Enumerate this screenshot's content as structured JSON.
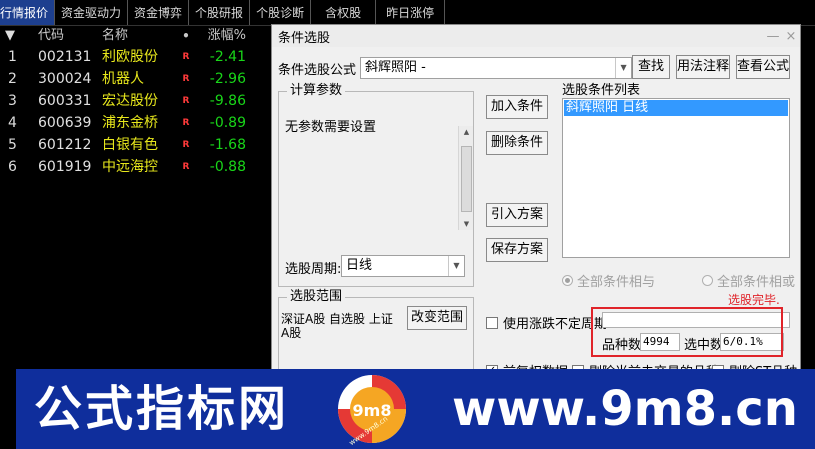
{
  "tabs": [
    "行情报价",
    "资金驱动力",
    "资金博弈",
    "个股研报",
    "个股诊断",
    "含权股",
    "昨日涨停"
  ],
  "table": {
    "headers": {
      "arrow": "▼",
      "code": "代码",
      "name": "名称",
      "flag": "•",
      "change": "涨幅%"
    },
    "rows": [
      {
        "idx": "1",
        "code": "002131",
        "name": "利欧股份",
        "flag": "R",
        "change": "-2.41"
      },
      {
        "idx": "2",
        "code": "300024",
        "name": "机器人",
        "flag": "R",
        "change": "-2.96"
      },
      {
        "idx": "3",
        "code": "600331",
        "name": "宏达股份",
        "flag": "R",
        "change": "-9.86"
      },
      {
        "idx": "4",
        "code": "600639",
        "name": "浦东金桥",
        "flag": "R",
        "change": "-0.89"
      },
      {
        "idx": "5",
        "code": "601212",
        "name": "白银有色",
        "flag": "R",
        "change": "-1.68"
      },
      {
        "idx": "6",
        "code": "601919",
        "name": "中远海控",
        "flag": "R",
        "change": "-0.88"
      }
    ]
  },
  "dialog": {
    "title": "条件选股",
    "close_glyph": "×",
    "formula_label": "条件选股公式",
    "formula_value": "斜辉照阳      -",
    "find_button": "查找",
    "usage_button": "用法注释",
    "view_formula_button": "查看公式",
    "params_group": "计算参数",
    "params_text": "无参数需要设置",
    "add_button": "加入条件",
    "delete_button": "删除条件",
    "import_button": "引入方案",
    "save_button": "保存方案",
    "cond_list_label": "选股条件列表",
    "cond_items": [
      "斜辉照阳   日线"
    ],
    "period_label": "选股周期:",
    "period_value": "日线",
    "radio_and": "全部条件相与",
    "radio_or": "全部条件相或",
    "range_group": "选股范围",
    "range_text_1": "深证A股 自选股 上证",
    "range_text_2": "A股",
    "change_range_button": "改变范围",
    "use_period_label": "使用涨跌不定周期",
    "status": "选股完毕.",
    "count_label": "品种数",
    "count_value": "4994",
    "selected_label": "选中数",
    "selected_value": "6/0.1%",
    "pre_restore_label": "前复权数据",
    "exclude_label": "剔除当前未交易的品种",
    "exclude2_label": "剔除ST品种"
  },
  "watermark": {
    "cn_text": "公式指标网",
    "url_text": "www.9m8.cn",
    "logo_text": "9m8",
    "logo_small": "www.9m8.cn"
  },
  "colors": {
    "tab_active": "#1d3f8f",
    "stock_name": "#e8e81c",
    "change_down": "#19d619",
    "flag_red": "#ff3a3a",
    "list_select": "#3399ff",
    "highlight_box": "#e0242a",
    "banner_bg": "#0f2e9c"
  }
}
